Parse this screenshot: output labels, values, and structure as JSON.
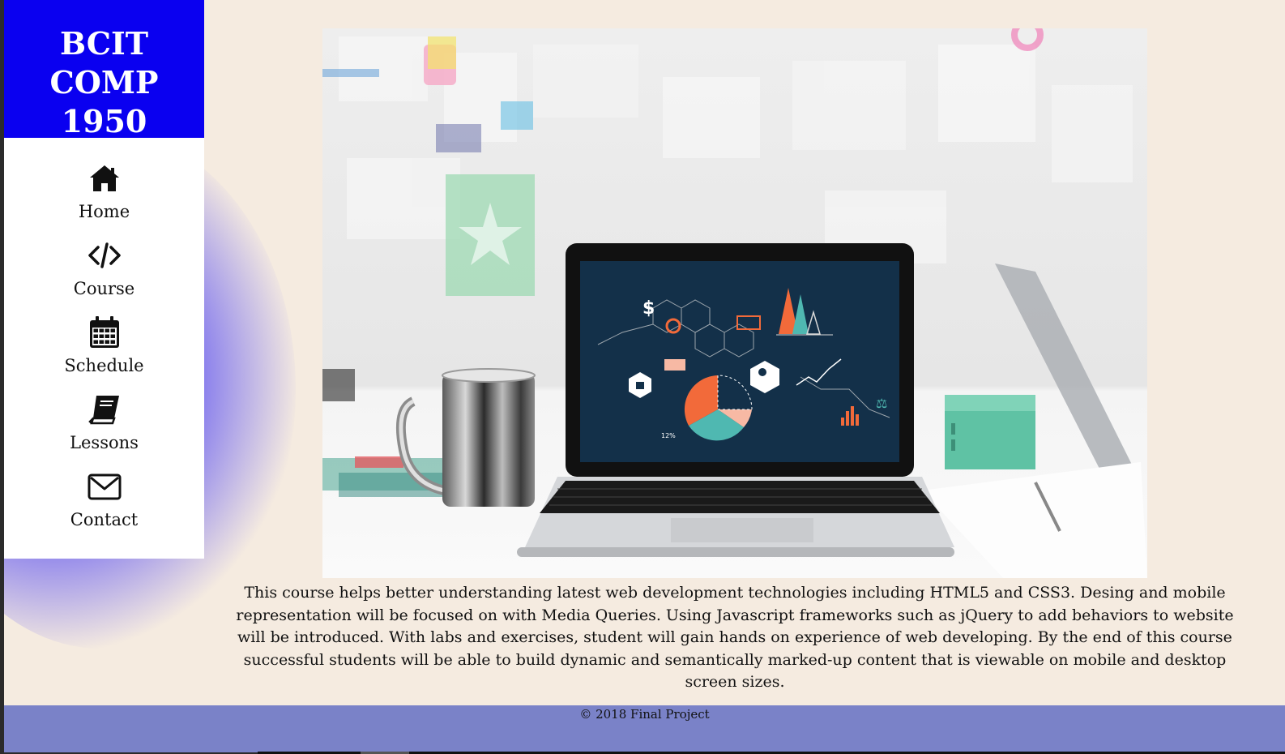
{
  "brand": {
    "line1": "BCIT COMP",
    "line2": "1950"
  },
  "nav": {
    "items": [
      {
        "label": "Home",
        "icon": "home-icon"
      },
      {
        "label": "Course",
        "icon": "code-icon"
      },
      {
        "label": "Schedule",
        "icon": "calendar-icon"
      },
      {
        "label": "Lessons",
        "icon": "book-icon"
      },
      {
        "label": "Contact",
        "icon": "envelope-icon"
      }
    ]
  },
  "hero": {
    "screen_text": "12%"
  },
  "main": {
    "description": "This course helps better understanding latest web development technologies including HTML5 and CSS3. Desing and mobile representation will be focused on with Media Queries. Using Javascript frameworks such as jQuery to add behaviors to website will be introduced. With labs and exercises, student will gain hands on experience of web developing. By the end of this course successful students will be able to build dynamic and semantically marked-up content that is viewable on mobile and desktop screen sizes."
  },
  "footer": {
    "text": "© 2018 Final Project"
  },
  "colors": {
    "brand_bg": "#0a00f0",
    "page_bg": "#f5ebe0",
    "footer_bg": "#7a82c8",
    "laptop_screen": "#133049",
    "accent_orange": "#f26a3a",
    "accent_teal": "#4fb8b1"
  }
}
